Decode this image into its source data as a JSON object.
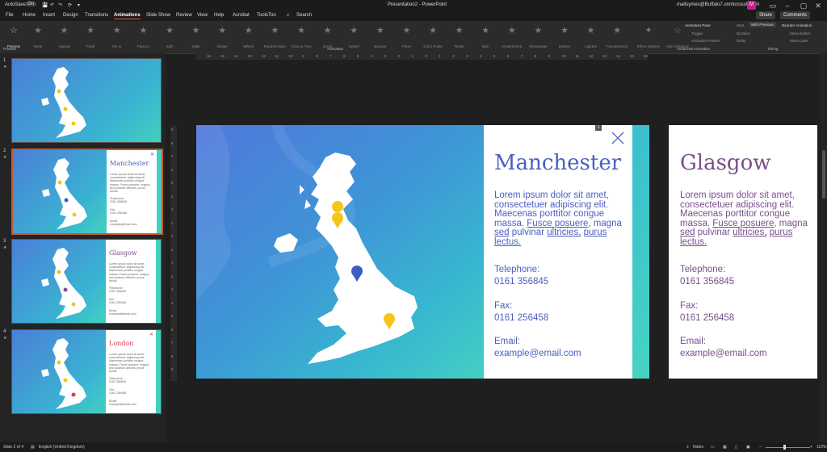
{
  "titlebar": {
    "autosave": "AutoSave",
    "autosave_state": "On",
    "doc_title": "Presentation2 - PowerPoint",
    "account": "maltsymes@Buffalo7.onmicrosoft.com",
    "avatar_initial": "M"
  },
  "menu": {
    "items": [
      "File",
      "Home",
      "Insert",
      "Design",
      "Transitions",
      "Animations",
      "Slide Show",
      "Review",
      "View",
      "Help",
      "Acrobat",
      "ToolsToo"
    ],
    "active": "Animations",
    "search": "Search",
    "share": "Share",
    "comments": "Comments"
  },
  "ribbon": {
    "preview": "Preview",
    "effects": [
      "None",
      "Appear",
      "Fade",
      "Fly In",
      "Float In",
      "Split",
      "Wipe",
      "Shape",
      "Wheel",
      "Random Bars",
      "Grow & Turn",
      "Zoom",
      "Swivel",
      "Bounce",
      "Pulse",
      "Color Pulse",
      "Teeter",
      "Spin",
      "Grow/Shrink",
      "Desaturate",
      "Darken",
      "Lighten",
      "Transparency"
    ],
    "effect_options": "Effect Options",
    "add_animation": "Add Animation",
    "animation_pane": "Animation Pane",
    "trigger": "Trigger",
    "animation_painter": "Animation Painter",
    "start_label": "Start",
    "start_value": "With Previous",
    "duration": "Duration",
    "delay": "Delay",
    "reorder": "Reorder Animation",
    "move_earlier": "Move Earlier",
    "move_later": "Move Later",
    "groups": {
      "preview": "Preview",
      "animation": "Animation",
      "advanced": "Advanced Animation",
      "timing": "Timing"
    }
  },
  "thumbnails": [
    {
      "num": "1",
      "city": "",
      "color": ""
    },
    {
      "num": "2",
      "city": "Manchester",
      "color": "#4a5fc1"
    },
    {
      "num": "3",
      "city": "Glasgow",
      "color": "#7a4e8c"
    },
    {
      "num": "4",
      "city": "London",
      "color": "#d63a5a"
    }
  ],
  "thumb_text": {
    "lorem": "Lorem ipsum dolor sit amet, consectetuer adipiscing elit. Maecenas porttitor congue massa. Fusce posuere, magna sed pulvinar ultricies, purus lectus.",
    "tel_label": "Telephone:",
    "tel": "0161 356845",
    "fax_label": "Fax:",
    "fax": "0161 256458",
    "email_label": "Email:",
    "email": "example@email.com"
  },
  "ruler": {
    "h": [
      "16",
      "15",
      "14",
      "13",
      "12",
      "11",
      "10",
      "9",
      "8",
      "7",
      "6",
      "5",
      "4",
      "3",
      "2",
      "1",
      "0",
      "1",
      "2",
      "3",
      "4",
      "5",
      "6",
      "7",
      "8",
      "9",
      "10",
      "11",
      "12",
      "13",
      "14",
      "15",
      "16"
    ],
    "v": [
      "9",
      "8",
      "7",
      "6",
      "5",
      "4",
      "3",
      "2",
      "1",
      "0",
      "1",
      "2",
      "3",
      "4",
      "5",
      "6",
      "7",
      "8",
      "9"
    ]
  },
  "slide": {
    "city": "Manchester",
    "city_color": "#4a5fc1",
    "lorem_1": "Lorem ipsum dolor sit amet, consectetuer adipiscing elit. Maecenas porttitor congue massa.",
    "lorem_u1": "Fusce posuere,",
    "lorem_2": "magna",
    "lorem_u2": "sed",
    "lorem_3": "pulvinar",
    "lorem_u3": "ultricies,",
    "lorem_u4": "purus lectus.",
    "tel_label": "Telephone:",
    "tel": "0161 356845",
    "fax_label": "Fax:",
    "fax": "0161 256458",
    "email_label": "Email:",
    "email": "example@email.com",
    "anim_tag": "1"
  },
  "side": {
    "city": "Glasgow",
    "city_color": "#7a4e8c"
  },
  "status": {
    "slide": "Slide 2 of 4",
    "language": "English (United Kingdom)",
    "notes": "Notes",
    "zoom": "110%"
  }
}
